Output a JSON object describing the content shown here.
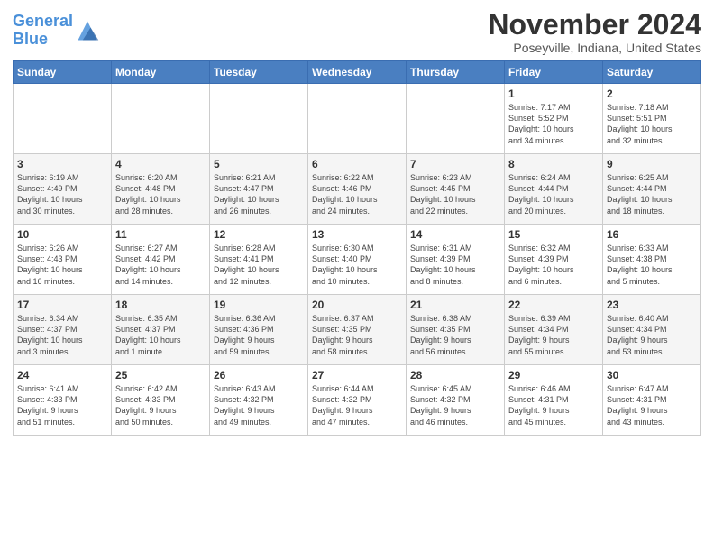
{
  "logo": {
    "line1": "General",
    "line2": "Blue"
  },
  "title": "November 2024",
  "subtitle": "Poseyville, Indiana, United States",
  "days_of_week": [
    "Sunday",
    "Monday",
    "Tuesday",
    "Wednesday",
    "Thursday",
    "Friday",
    "Saturday"
  ],
  "weeks": [
    [
      {
        "day": "",
        "info": ""
      },
      {
        "day": "",
        "info": ""
      },
      {
        "day": "",
        "info": ""
      },
      {
        "day": "",
        "info": ""
      },
      {
        "day": "",
        "info": ""
      },
      {
        "day": "1",
        "info": "Sunrise: 7:17 AM\nSunset: 5:52 PM\nDaylight: 10 hours\nand 34 minutes."
      },
      {
        "day": "2",
        "info": "Sunrise: 7:18 AM\nSunset: 5:51 PM\nDaylight: 10 hours\nand 32 minutes."
      }
    ],
    [
      {
        "day": "3",
        "info": "Sunrise: 6:19 AM\nSunset: 4:49 PM\nDaylight: 10 hours\nand 30 minutes."
      },
      {
        "day": "4",
        "info": "Sunrise: 6:20 AM\nSunset: 4:48 PM\nDaylight: 10 hours\nand 28 minutes."
      },
      {
        "day": "5",
        "info": "Sunrise: 6:21 AM\nSunset: 4:47 PM\nDaylight: 10 hours\nand 26 minutes."
      },
      {
        "day": "6",
        "info": "Sunrise: 6:22 AM\nSunset: 4:46 PM\nDaylight: 10 hours\nand 24 minutes."
      },
      {
        "day": "7",
        "info": "Sunrise: 6:23 AM\nSunset: 4:45 PM\nDaylight: 10 hours\nand 22 minutes."
      },
      {
        "day": "8",
        "info": "Sunrise: 6:24 AM\nSunset: 4:44 PM\nDaylight: 10 hours\nand 20 minutes."
      },
      {
        "day": "9",
        "info": "Sunrise: 6:25 AM\nSunset: 4:44 PM\nDaylight: 10 hours\nand 18 minutes."
      }
    ],
    [
      {
        "day": "10",
        "info": "Sunrise: 6:26 AM\nSunset: 4:43 PM\nDaylight: 10 hours\nand 16 minutes."
      },
      {
        "day": "11",
        "info": "Sunrise: 6:27 AM\nSunset: 4:42 PM\nDaylight: 10 hours\nand 14 minutes."
      },
      {
        "day": "12",
        "info": "Sunrise: 6:28 AM\nSunset: 4:41 PM\nDaylight: 10 hours\nand 12 minutes."
      },
      {
        "day": "13",
        "info": "Sunrise: 6:30 AM\nSunset: 4:40 PM\nDaylight: 10 hours\nand 10 minutes."
      },
      {
        "day": "14",
        "info": "Sunrise: 6:31 AM\nSunset: 4:39 PM\nDaylight: 10 hours\nand 8 minutes."
      },
      {
        "day": "15",
        "info": "Sunrise: 6:32 AM\nSunset: 4:39 PM\nDaylight: 10 hours\nand 6 minutes."
      },
      {
        "day": "16",
        "info": "Sunrise: 6:33 AM\nSunset: 4:38 PM\nDaylight: 10 hours\nand 5 minutes."
      }
    ],
    [
      {
        "day": "17",
        "info": "Sunrise: 6:34 AM\nSunset: 4:37 PM\nDaylight: 10 hours\nand 3 minutes."
      },
      {
        "day": "18",
        "info": "Sunrise: 6:35 AM\nSunset: 4:37 PM\nDaylight: 10 hours\nand 1 minute."
      },
      {
        "day": "19",
        "info": "Sunrise: 6:36 AM\nSunset: 4:36 PM\nDaylight: 9 hours\nand 59 minutes."
      },
      {
        "day": "20",
        "info": "Sunrise: 6:37 AM\nSunset: 4:35 PM\nDaylight: 9 hours\nand 58 minutes."
      },
      {
        "day": "21",
        "info": "Sunrise: 6:38 AM\nSunset: 4:35 PM\nDaylight: 9 hours\nand 56 minutes."
      },
      {
        "day": "22",
        "info": "Sunrise: 6:39 AM\nSunset: 4:34 PM\nDaylight: 9 hours\nand 55 minutes."
      },
      {
        "day": "23",
        "info": "Sunrise: 6:40 AM\nSunset: 4:34 PM\nDaylight: 9 hours\nand 53 minutes."
      }
    ],
    [
      {
        "day": "24",
        "info": "Sunrise: 6:41 AM\nSunset: 4:33 PM\nDaylight: 9 hours\nand 51 minutes."
      },
      {
        "day": "25",
        "info": "Sunrise: 6:42 AM\nSunset: 4:33 PM\nDaylight: 9 hours\nand 50 minutes."
      },
      {
        "day": "26",
        "info": "Sunrise: 6:43 AM\nSunset: 4:32 PM\nDaylight: 9 hours\nand 49 minutes."
      },
      {
        "day": "27",
        "info": "Sunrise: 6:44 AM\nSunset: 4:32 PM\nDaylight: 9 hours\nand 47 minutes."
      },
      {
        "day": "28",
        "info": "Sunrise: 6:45 AM\nSunset: 4:32 PM\nDaylight: 9 hours\nand 46 minutes."
      },
      {
        "day": "29",
        "info": "Sunrise: 6:46 AM\nSunset: 4:31 PM\nDaylight: 9 hours\nand 45 minutes."
      },
      {
        "day": "30",
        "info": "Sunrise: 6:47 AM\nSunset: 4:31 PM\nDaylight: 9 hours\nand 43 minutes."
      }
    ]
  ]
}
